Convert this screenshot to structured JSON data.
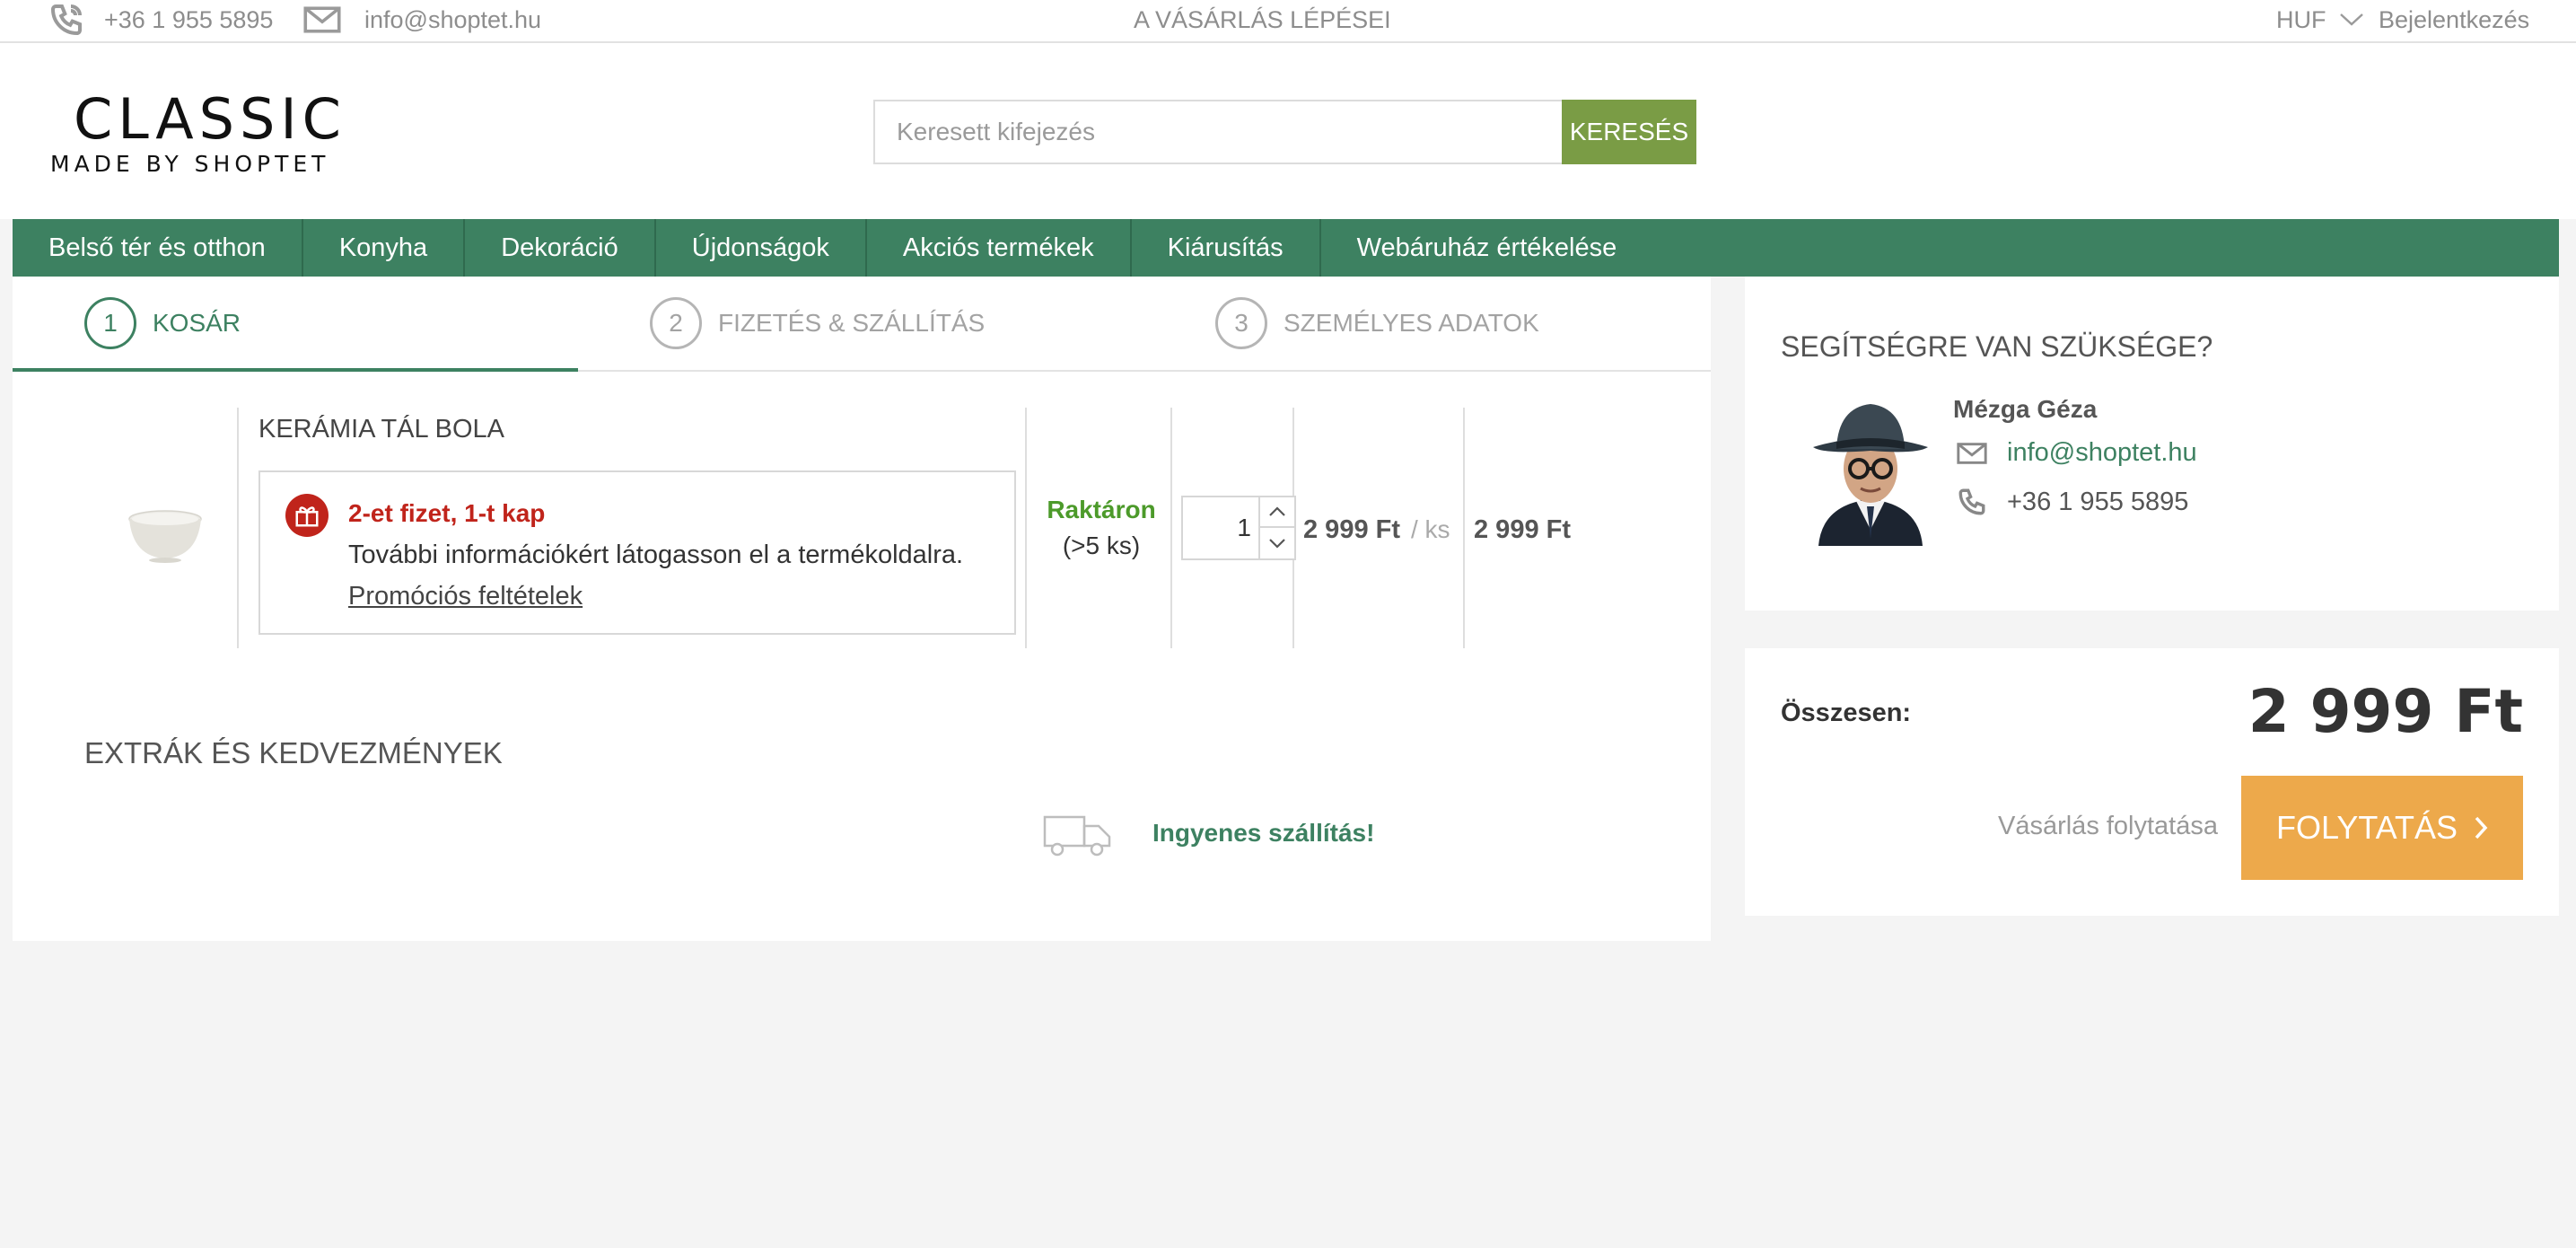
{
  "topbar": {
    "phone": "+36 1 955 5895",
    "email": "info@shoptet.hu",
    "steps_link": "A VÁSÁRLÁS LÉPÉSEI",
    "currency": "HUF",
    "login": "Bejelentkezés"
  },
  "logo": {
    "main": "CLASSIC",
    "sub": "MADE BY SHOPTET"
  },
  "search": {
    "placeholder": "Keresett kifejezés",
    "button": "KERESÉS"
  },
  "nav": {
    "items": [
      "Belső tér és otthon",
      "Konyha",
      "Dekoráció",
      "Újdonságok",
      "Akciós termékek",
      "Kiárusítás",
      "Webáruház értékelése"
    ]
  },
  "steps": [
    {
      "num": "1",
      "label": "KOSÁR",
      "active": true
    },
    {
      "num": "2",
      "label": "FIZETÉS & SZÁLLÍTÁS",
      "active": false
    },
    {
      "num": "3",
      "label": "SZEMÉLYES ADATOK",
      "active": false
    }
  ],
  "cart": {
    "product_name": "KERÁMIA TÁL BOLA",
    "promo": {
      "title": "2-et fizet, 1-t kap",
      "text": "További információkért látogasson el a termékoldalra.",
      "link": "Promóciós feltételek"
    },
    "stock": {
      "status": "Raktáron",
      "amount": "(>5 ks)"
    },
    "quantity": "1",
    "unit_price": "2 999 Ft",
    "per_unit": "/ ks",
    "total_price": "2 999 Ft"
  },
  "extras": {
    "title": "EXTRÁK ÉS KEDVEZMÉNYEK",
    "free_shipping": "Ingyenes szállítás!"
  },
  "help": {
    "title": "SEGÍTSÉGRE VAN SZÜKSÉGE?",
    "agent_name": "Mézga Géza",
    "email": "info@shoptet.hu",
    "phone": "+36 1 955 5895"
  },
  "summary": {
    "total_label": "Összesen:",
    "total_value": "2 999 Ft",
    "continue_shopping": "Vásárlás folytatása",
    "continue_button": "FOLYTATÁS"
  },
  "colors": {
    "brand_green": "#3d8161",
    "search_green": "#7a9c45",
    "promo_red": "#c0241b",
    "stock_green": "#4c9a2a",
    "cta_orange": "#eda94b"
  }
}
